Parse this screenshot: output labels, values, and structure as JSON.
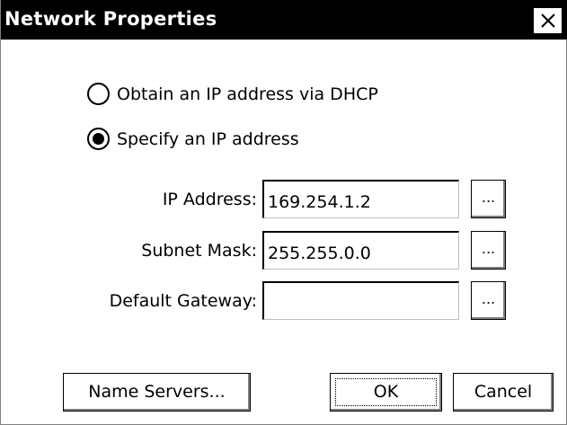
{
  "window": {
    "title": "Network Properties",
    "close_icon": "close-icon"
  },
  "ip_mode": {
    "options": [
      {
        "label": "Obtain an IP address via DHCP",
        "selected": false
      },
      {
        "label": "Specify an IP address",
        "selected": true
      }
    ]
  },
  "fields": {
    "ip_address": {
      "label": "IP Address:",
      "value": "169.254.1.2"
    },
    "subnet_mask": {
      "label": "Subnet Mask:",
      "value": "255.255.0.0"
    },
    "default_gateway": {
      "label": "Default Gateway:",
      "value": ""
    }
  },
  "browse_label": "...",
  "buttons": {
    "name_servers": "Name Servers...",
    "ok": "OK",
    "cancel": "Cancel"
  }
}
